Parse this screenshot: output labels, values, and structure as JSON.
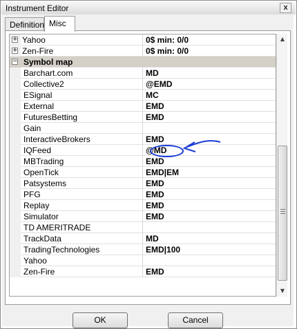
{
  "window": {
    "title": "Instrument Editor",
    "close_glyph": "x"
  },
  "tabs": [
    {
      "label": "Definition",
      "active": false
    },
    {
      "label": "Misc",
      "active": true
    }
  ],
  "grid": {
    "top_rows": [
      {
        "key": "Yahoo",
        "value": "0$ min:  0/0",
        "expand_glyph": "+"
      },
      {
        "key": "Zen-Fire",
        "value": "0$ min:  0/0",
        "expand_glyph": "+"
      }
    ],
    "category": {
      "label": "Symbol map",
      "collapse_glyph": "−"
    },
    "symbol_map": [
      {
        "key": "Barchart.com",
        "value": "MD"
      },
      {
        "key": "Collective2",
        "value": "@EMD"
      },
      {
        "key": "ESignal",
        "value": "MC"
      },
      {
        "key": "External",
        "value": "EMD"
      },
      {
        "key": "FuturesBetting",
        "value": "EMD"
      },
      {
        "key": "Gain",
        "value": ""
      },
      {
        "key": "InteractiveBrokers",
        "value": "EMD"
      },
      {
        "key": "IQFeed",
        "value": "@MD"
      },
      {
        "key": "MBTrading",
        "value": "EMD"
      },
      {
        "key": "OpenTick",
        "value": "EMD|EM"
      },
      {
        "key": "Patsystems",
        "value": "EMD"
      },
      {
        "key": "PFG",
        "value": "EMD"
      },
      {
        "key": "Replay",
        "value": "EMD"
      },
      {
        "key": "Simulator",
        "value": "EMD"
      },
      {
        "key": "TD AMERITRADE",
        "value": ""
      },
      {
        "key": "TrackData",
        "value": "MD"
      },
      {
        "key": "TradingTechnologies",
        "value": "EMD|100"
      },
      {
        "key": "Yahoo",
        "value": ""
      },
      {
        "key": "Zen-Fire",
        "value": "EMD"
      }
    ]
  },
  "buttons": {
    "ok": "OK",
    "cancel": "Cancel"
  },
  "colors": {
    "annotation": "#1a3bd6",
    "category_bg": "#d4d0c8"
  }
}
